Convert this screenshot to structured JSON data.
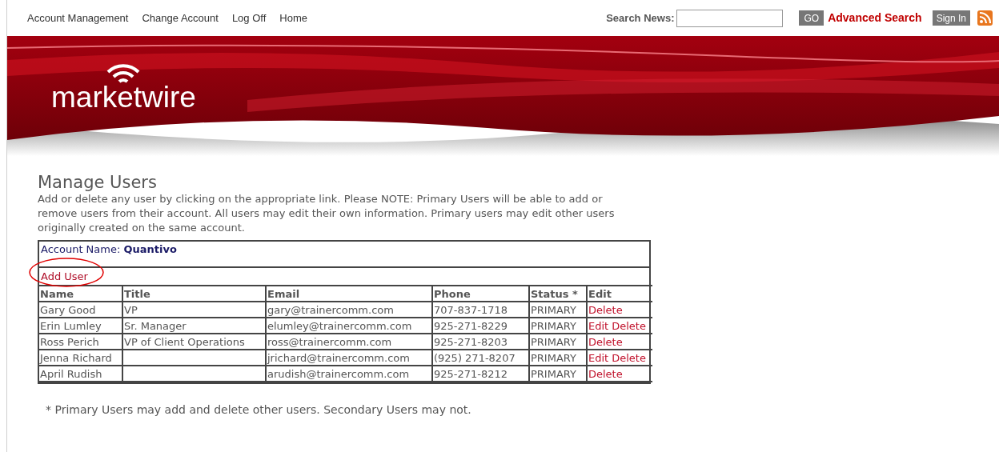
{
  "top_nav": {
    "links": [
      "Account Management",
      "Change Account",
      "Log Off",
      "Home"
    ],
    "search_label": "Search News:",
    "go_button": "GO",
    "advanced_search": "Advanced Search",
    "sign_in": "Sign In"
  },
  "banner": {
    "logo": "marketwire"
  },
  "page": {
    "title": "Manage Users",
    "description": "Add or delete any user by clicking on the appropriate link. Please NOTE: Primary Users will be able to add or remove users from their account. All users may edit their own information. Primary users may edit other users originally created on the same account."
  },
  "account": {
    "label": "Account Name:",
    "name": "Quantivo",
    "add_user": "Add User",
    "add_user_circled": true
  },
  "table": {
    "columns": [
      "Name",
      "Title",
      "Email",
      "Phone",
      "Status *",
      "Edit"
    ],
    "rows": [
      {
        "name": "Gary Good",
        "title": "VP",
        "email": "gary@trainercomm.com",
        "phone": "707-837-1718",
        "status": "PRIMARY",
        "actions": [
          "Delete"
        ]
      },
      {
        "name": "Erin Lumley",
        "title": "Sr. Manager",
        "email": "elumley@trainercomm.com",
        "phone": "925-271-8229",
        "status": "PRIMARY",
        "actions": [
          "Edit",
          "Delete"
        ]
      },
      {
        "name": "Ross Perich",
        "title": "VP of Client Operations",
        "email": "ross@trainercomm.com",
        "phone": "925-271-8203",
        "status": "PRIMARY",
        "actions": [
          "Delete"
        ]
      },
      {
        "name": "Jenna Richard",
        "title": "",
        "email": "jrichard@trainercomm.com",
        "phone": "(925) 271-8207",
        "status": "PRIMARY",
        "actions": [
          "Edit",
          "Delete"
        ]
      },
      {
        "name": "April Rudish",
        "title": "",
        "email": "arudish@trainercomm.com",
        "phone": "925-271-8212",
        "status": "PRIMARY",
        "actions": [
          "Delete"
        ]
      }
    ]
  },
  "footnote": "* Primary Users may add and delete other users. Secondary Users may not."
}
